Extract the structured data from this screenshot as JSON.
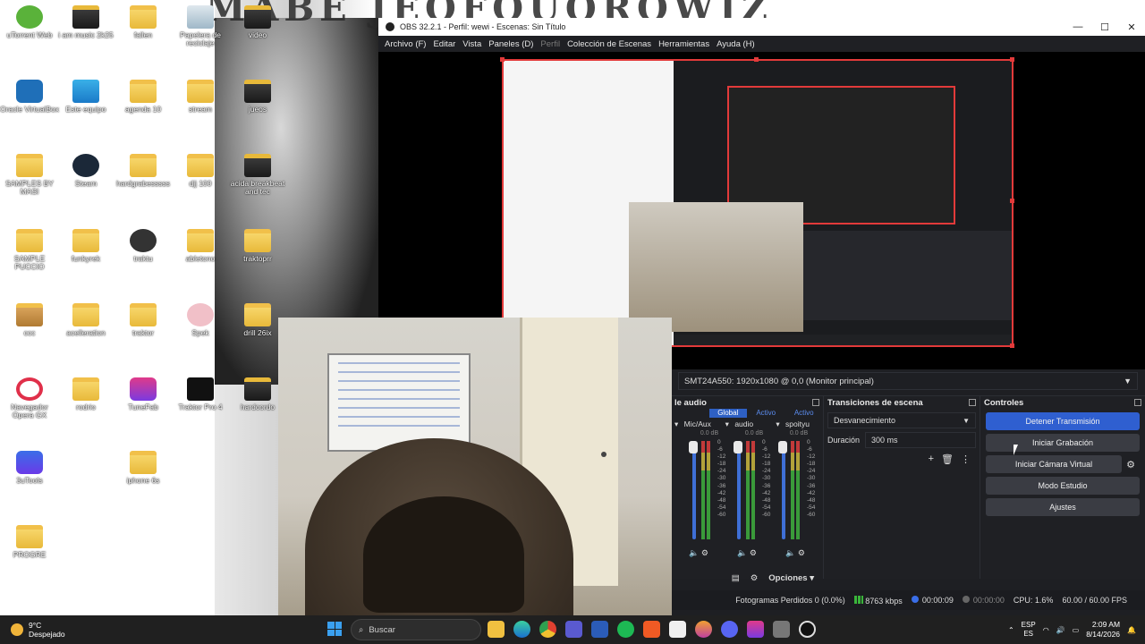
{
  "desktop": {
    "banner": "MABE JEOFOUQROWJZ",
    "icons": [
      {
        "label": "uTorrent Web",
        "icon": "utorrent-icon"
      },
      {
        "label": "i am music 2k25",
        "icon": "folder-icon"
      },
      {
        "label": "fallen",
        "icon": "folder-icon"
      },
      {
        "label": "Papelera de reciclaje",
        "icon": "recycle-bin-icon"
      },
      {
        "label": "video",
        "icon": "folder-icon"
      },
      {
        "label": "Oracle VirtualBox",
        "icon": "virtualbox-icon"
      },
      {
        "label": "Este equipo",
        "icon": "monitor-icon"
      },
      {
        "label": "agenda 10",
        "icon": "folder-icon"
      },
      {
        "label": "stream",
        "icon": "folder-icon"
      },
      {
        "label": "jueos",
        "icon": "folder-icon"
      },
      {
        "label": "SAMPLES BY MASI",
        "icon": "folder-icon"
      },
      {
        "label": "Steam",
        "icon": "steam-icon"
      },
      {
        "label": "hardgrabesssss",
        "icon": "folder-icon"
      },
      {
        "label": "djj 100",
        "icon": "folder-icon"
      },
      {
        "label": "acida breakbeat and tec",
        "icon": "folder-icon"
      },
      {
        "label": "SAMPLE PUCCIO",
        "icon": "folder-icon"
      },
      {
        "label": "funkyrek",
        "icon": "folder-icon"
      },
      {
        "label": "traktu",
        "icon": "folder-icon"
      },
      {
        "label": "abletono",
        "icon": "folder-icon"
      },
      {
        "label": "traktoprr",
        "icon": "folder-icon"
      },
      {
        "label": "ccc",
        "icon": "folder-icon"
      },
      {
        "label": "acelleration",
        "icon": "folder-icon"
      },
      {
        "label": "traktor",
        "icon": "folder-icon"
      },
      {
        "label": "Spek",
        "icon": "spek-icon"
      },
      {
        "label": "drill 26ix",
        "icon": "folder-icon"
      },
      {
        "label": "Navegador Opera GX",
        "icon": "opera-gx-icon"
      },
      {
        "label": "rodrio",
        "icon": "folder-icon"
      },
      {
        "label": "TuneFab",
        "icon": "tunefab-icon"
      },
      {
        "label": "Traktor Pro 4",
        "icon": "traktor-icon"
      },
      {
        "label": "hardcordo",
        "icon": "folder-icon"
      },
      {
        "label": "3uTools",
        "icon": "3utools-icon"
      },
      {
        "label": "iphone 6s",
        "icon": "folder-icon"
      },
      {
        "label": "PROGRE",
        "icon": "folder-icon"
      }
    ]
  },
  "obs": {
    "title": "OBS 32.2.1 - Perfil: wewi - Escenas: Sin Título",
    "window_controls": {
      "minimize": "—",
      "maximize": "☐",
      "close": "✕"
    },
    "menu": [
      {
        "label": "Archivo (F)",
        "enabled": true
      },
      {
        "label": "Editar",
        "enabled": true
      },
      {
        "label": "Vista",
        "enabled": true
      },
      {
        "label": "Paneles (D)",
        "enabled": true
      },
      {
        "label": "Perfil",
        "enabled": false
      },
      {
        "label": "Colección de Escenas",
        "enabled": true
      },
      {
        "label": "Herramientas",
        "enabled": true
      },
      {
        "label": "Ayuda (H)",
        "enabled": true
      }
    ],
    "source_select": "SMT24A550: 1920x1080 @ 0,0 (Monitor principal)",
    "audio": {
      "title": "le audio",
      "header": [
        "",
        "Global",
        "Activo",
        "Activo"
      ],
      "channels": [
        {
          "name": "Mic/Aux",
          "db": "0.0 dB"
        },
        {
          "name": "audio",
          "db": "0.0 dB"
        },
        {
          "name": "spoityu",
          "db": "0.0 dB"
        }
      ],
      "ticks": [
        "0",
        "-6",
        "-12",
        "-18",
        "-24",
        "-30",
        "-36",
        "-42",
        "-48",
        "-54",
        "-60"
      ]
    },
    "transitions": {
      "title": "Transiciones de escena",
      "type": "Desvanecimiento",
      "duration_label": "Duración",
      "duration_value": "300 ms"
    },
    "controls": {
      "title": "Controles",
      "stop_stream": "Detener Transmisión",
      "start_recording": "Iniciar Grabación",
      "start_virtual_cam": "Iniciar Cámara Virtual",
      "studio_mode": "Modo Estudio",
      "settings": "Ajustes"
    },
    "footer": {
      "options": "Opciones"
    },
    "status": {
      "dropped_frames": "Fotogramas Perdidos 0 (0.0%)",
      "bitrate": "8763 kbps",
      "stream_time": "00:00:09",
      "record_time": "00:00:00",
      "cpu": "CPU: 1.6%",
      "fps": "60.00 / 60.00 FPS"
    }
  },
  "taskbar": {
    "temperature": "9°C",
    "weather": "Despejado",
    "search_placeholder": "Buscar",
    "apps": [
      "file-explorer-icon",
      "edge-icon",
      "chrome-icon",
      "teams-icon",
      "word-icon",
      "spotify-icon",
      "brave-icon",
      "notepad-icon",
      "firefox-icon",
      "discord-icon",
      "tunefab-icon",
      "settings-icon",
      "obs-icon"
    ],
    "lang_top": "ESP",
    "lang_bottom": "ES",
    "time": "2:09 AM",
    "date": "8/14/2026"
  },
  "colors": {
    "accent": "#2f5fd0",
    "obs_bg": "#1e1f23",
    "selection_red": "#e23a3a",
    "folder": "#f1c04a"
  }
}
